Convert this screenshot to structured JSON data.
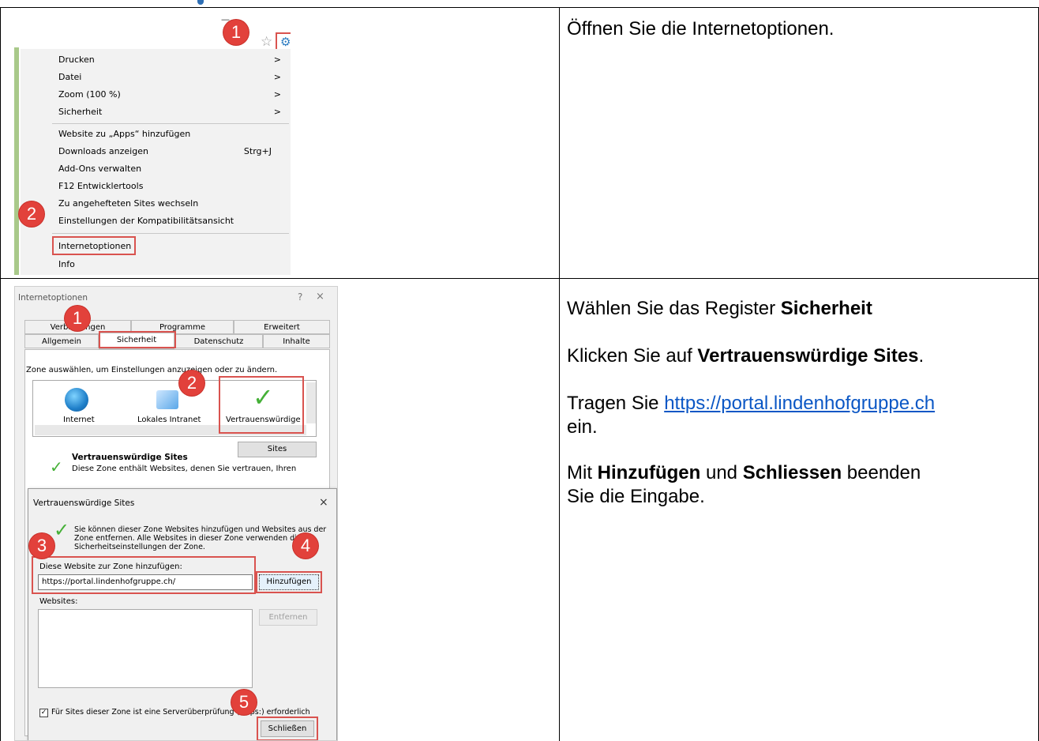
{
  "row1": {
    "instruction": "Öffnen Sie die Internetoptionen.",
    "badges": [
      "1",
      "2"
    ],
    "menu": {
      "items": [
        {
          "label": "Drucken",
          "arrow": ">"
        },
        {
          "label": "Datei",
          "arrow": ">"
        },
        {
          "label": "Zoom (100 %)",
          "arrow": ">"
        },
        {
          "label": "Sicherheit",
          "arrow": ">"
        },
        {
          "label": "Website zu „Apps“ hinzufügen"
        },
        {
          "label": "Downloads anzeigen",
          "shortcut": "Strg+J"
        },
        {
          "label": "Add-Ons verwalten"
        },
        {
          "label": "F12 Entwicklertools"
        },
        {
          "label": "Zu angehefteten Sites wechseln"
        },
        {
          "label": "Einstellungen der Kompatibilitätsansicht"
        },
        {
          "label": "Internetoptionen"
        },
        {
          "label": "Info"
        }
      ]
    }
  },
  "row2": {
    "instruction": {
      "p1_prefix": "Wählen Sie das Register ",
      "p1_bold": "Sicherheit",
      "p2_prefix": "Klicken Sie auf ",
      "p2_bold": "Vertrauenswürdige Sites",
      "p2_suffix": ".",
      "p3_prefix": "Tragen Sie ",
      "p3_link": "https://portal.lindenhofgruppe.ch",
      "p3_suffix": "ein.",
      "p4_prefix": "Mit ",
      "p4_bold1": "Hinzufügen",
      "p4_mid": " und ",
      "p4_bold2": "Schliessen",
      "p4_suffix": " beenden",
      "p4_line2": "Sie die Eingabe."
    },
    "badges": [
      "1",
      "2",
      "3",
      "4",
      "5"
    ],
    "dialog": {
      "title": "Internetoptionen",
      "help": "?",
      "close": "×",
      "tabs_back": [
        "Verbindungen",
        "Programme",
        "Erweitert"
      ],
      "tabs_front": [
        "Allgemein",
        "Sicherheit",
        "Datenschutz",
        "Inhalte"
      ],
      "zone_prompt": "Zone auswählen, um Einstellungen anzuzeigen oder zu ändern.",
      "zones": [
        "Internet",
        "Lokales Intranet",
        "Vertrauenswürdige"
      ],
      "sites_button": "Sites",
      "zone_heading": "Vertrauenswürdige Sites",
      "zone_desc": "Diese Zone enthält Websites, denen Sie vertrauen, Ihren"
    },
    "subdialog": {
      "title": "Vertrauenswürdige Sites",
      "close": "×",
      "info": "Sie können dieser Zone Websites hinzufügen und Websites aus der Zone entfernen. Alle Websites in dieser Zone verwenden die Sicherheitseinstellungen der Zone.",
      "add_label": "Diese Website zur Zone hinzufügen:",
      "url_value": "https://portal.lindenhofgruppe.ch/",
      "add_button": "Hinzufügen",
      "websites_label": "Websites:",
      "remove_button": "Entfernen",
      "checkbox_label": "Für Sites dieser Zone ist eine Serverüberprüfung (https:) erforderlich",
      "close_button": "Schließen"
    }
  }
}
